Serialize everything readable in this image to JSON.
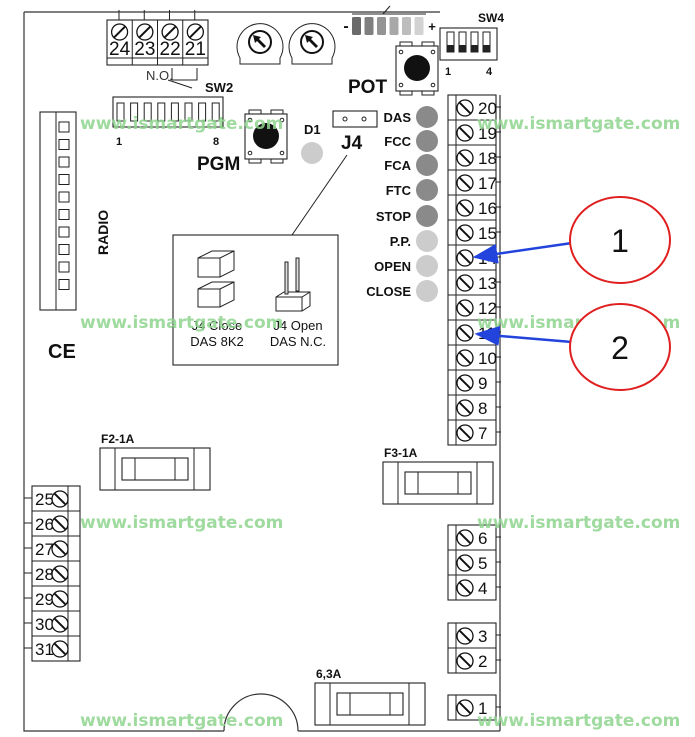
{
  "top_terminals": [
    "24",
    "23",
    "22",
    "21"
  ],
  "no_label": "N.O.",
  "sw2": {
    "label": "SW2",
    "first": "1",
    "last": "8"
  },
  "sw4": {
    "label": "SW4",
    "first": "1",
    "last": "4"
  },
  "pot_label": "POT",
  "pgm_label": "PGM",
  "d1_label": "D1",
  "j4_label": "J4",
  "led_bar": {
    "minus": "-",
    "plus": "+"
  },
  "leds": [
    {
      "label": "DAS",
      "color": "#8a8a8a"
    },
    {
      "label": "FCC",
      "color": "#8a8a8a"
    },
    {
      "label": "FCA",
      "color": "#8a8a8a"
    },
    {
      "label": "FTC",
      "color": "#8a8a8a"
    },
    {
      "label": "STOP",
      "color": "#8a8a8a"
    },
    {
      "label": "P.P.",
      "color": "#cccccc"
    },
    {
      "label": "OPEN",
      "color": "#cccccc"
    },
    {
      "label": "CLOSE",
      "color": "#cccccc"
    }
  ],
  "jumper_box": {
    "close_line1": "J4 Close",
    "close_line2": "DAS 8K2",
    "open_line1": "J4 Open",
    "open_line2": "DAS N.C."
  },
  "radio_label": "RADIO",
  "ce_mark": "CE",
  "right_terminals": [
    "20",
    "19",
    "18",
    "17",
    "16",
    "15",
    "14",
    "13",
    "12",
    "11",
    "10",
    "9",
    "8",
    "7"
  ],
  "right_terminals_mid": [
    "6",
    "5",
    "4"
  ],
  "right_terminals_low": [
    "3",
    "2"
  ],
  "right_terminals_bottom": [
    "1"
  ],
  "left_terminals": [
    "25",
    "26",
    "27",
    "28",
    "29",
    "30",
    "31"
  ],
  "fuses": {
    "f2": "F2-1A",
    "f3": "F3-1A",
    "main": "6,3A"
  },
  "callouts": [
    {
      "label": "1",
      "target_terminal": "14"
    },
    {
      "label": "2",
      "target_terminal": "11"
    }
  ],
  "watermark": "www.ismartgate.com",
  "colors": {
    "callout_circle": "#e02020",
    "arrow": "#2244dd",
    "watermark": "#8fd48f"
  }
}
